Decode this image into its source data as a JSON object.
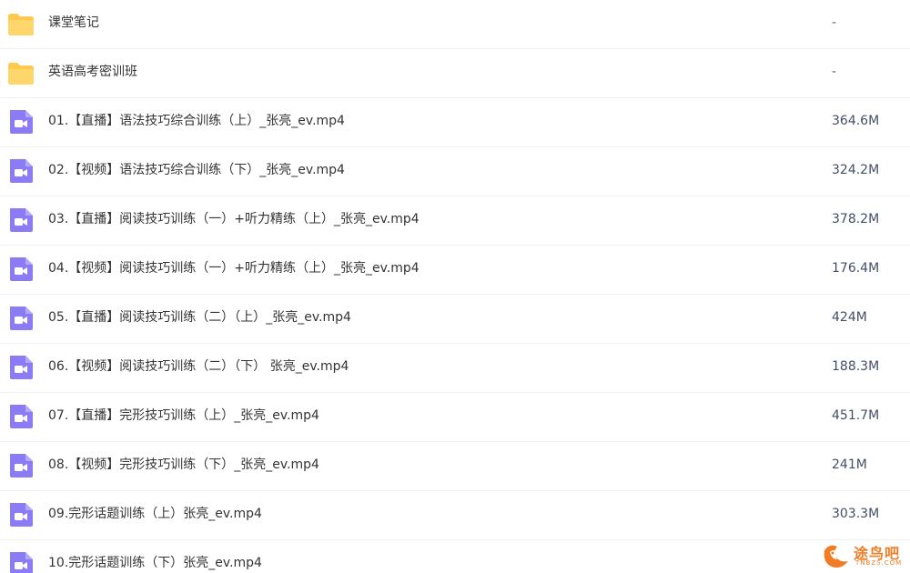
{
  "files": [
    {
      "type": "folder",
      "name": "课堂笔记",
      "size": "-"
    },
    {
      "type": "folder",
      "name": "英语高考密训班",
      "size": "-"
    },
    {
      "type": "video",
      "name": "01.【直播】语法技巧综合训练（上）_张亮_ev.mp4",
      "size": "364.6M"
    },
    {
      "type": "video",
      "name": "02.【视频】语法技巧综合训练（下）_张亮_ev.mp4",
      "size": "324.2M"
    },
    {
      "type": "video",
      "name": "03.【直播】阅读技巧训练（一）+听力精练（上）_张亮_ev.mp4",
      "size": "378.2M"
    },
    {
      "type": "video",
      "name": "04.【视频】阅读技巧训练（一）+听力精练（上）_张亮_ev.mp4",
      "size": "176.4M"
    },
    {
      "type": "video",
      "name": "05.【直播】阅读技巧训练（二）（上）_张亮_ev.mp4",
      "size": "424M"
    },
    {
      "type": "video",
      "name": "06.【视频】阅读技巧训练（二）（下） 张亮_ev.mp4",
      "size": "188.3M"
    },
    {
      "type": "video",
      "name": "07.【直播】完形技巧训练（上）_张亮_ev.mp4",
      "size": "451.7M"
    },
    {
      "type": "video",
      "name": "08.【视频】完形技巧训练（下）_张亮_ev.mp4",
      "size": "241M"
    },
    {
      "type": "video",
      "name": "09.完形话题训练（上）张亮_ev.mp4",
      "size": "303.3M"
    },
    {
      "type": "video",
      "name": "10.完形话题训练（下）张亮_ev.mp4",
      "size": ""
    }
  ],
  "icons": {
    "folder": "folder-icon",
    "video": "video-file-icon"
  },
  "colors": {
    "folder": "#ffc94d",
    "video": "#8b7cf6",
    "watermark": "#f07d24"
  },
  "watermark": {
    "text": "途鸟吧",
    "sub": "TNBZS.COM"
  }
}
